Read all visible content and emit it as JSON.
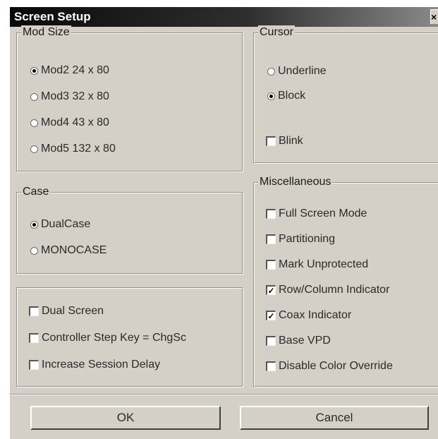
{
  "window": {
    "title": "Screen Setup",
    "close_glyph": "×"
  },
  "mod_size": {
    "legend": "Mod Size",
    "options": [
      {
        "label": "Mod2 24 x 80",
        "selected": true
      },
      {
        "label": "Mod3 32 x 80",
        "selected": false
      },
      {
        "label": "Mod4 43 x 80",
        "selected": false
      },
      {
        "label": "Mod5 132 x 80",
        "selected": false
      }
    ]
  },
  "case": {
    "legend": "Case",
    "options": [
      {
        "label": "DualCase",
        "selected": true
      },
      {
        "label": "MONOCASE",
        "selected": false
      }
    ]
  },
  "screen_options": {
    "checkboxes": [
      {
        "label": "Dual Screen",
        "checked": false
      },
      {
        "label": "Controller Step Key = ChgSc",
        "checked": false
      },
      {
        "label": "Increase Session Delay",
        "checked": false
      }
    ]
  },
  "cursor": {
    "legend": "Cursor",
    "options": [
      {
        "label": "Underline",
        "selected": false
      },
      {
        "label": "Block",
        "selected": true
      }
    ],
    "blink": {
      "label": "Blink",
      "checked": false
    }
  },
  "miscellaneous": {
    "legend": "Miscellaneous",
    "checkboxes": [
      {
        "label": "Full Screen Mode",
        "checked": false
      },
      {
        "label": "Partitioning",
        "checked": false
      },
      {
        "label": "Mark Unprotected",
        "checked": false
      },
      {
        "label": "Row/Column Indicator",
        "checked": true
      },
      {
        "label": "Coax Indicator",
        "checked": true
      },
      {
        "label": "Base VPD",
        "checked": false
      },
      {
        "label": "Disable Color Override",
        "checked": false
      }
    ]
  },
  "buttons": {
    "ok": "OK",
    "cancel": "Cancel"
  }
}
